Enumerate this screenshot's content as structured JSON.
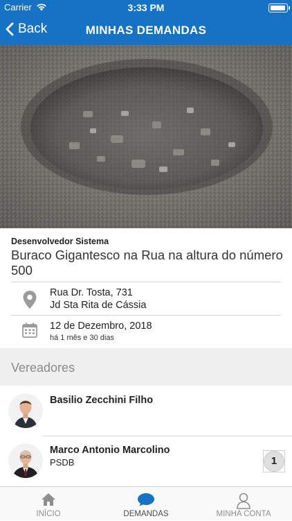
{
  "status_bar": {
    "carrier": "Carrier",
    "time": "3:33 PM"
  },
  "navbar": {
    "back_label": "Back",
    "title": "MINHAS DEMANDAS"
  },
  "demand": {
    "author": "Desenvolvedor Sistema",
    "title": "Buraco Gigantesco na Rua na altura do número 500",
    "address_line1": "Rua Dr. Tosta, 731",
    "address_line2": "Jd Sta Rita de Cássia",
    "date": "12 de Dezembro, 2018",
    "elapsed": "há 1 mês e 30 dias"
  },
  "section": {
    "title": "Vereadores"
  },
  "councilors": [
    {
      "name": "Basilio Zecchini Filho",
      "party": ""
    },
    {
      "name": "Marco Antonio Marcolino",
      "party": "PSDB",
      "badge": "1"
    }
  ],
  "tabbar": {
    "tabs": [
      {
        "label": "INÍCIO",
        "icon": "home-icon"
      },
      {
        "label": "DEMANDAS",
        "icon": "chat-bubble-icon",
        "active": true
      },
      {
        "label": "MINHA CONTA",
        "icon": "user-icon"
      }
    ]
  },
  "colors": {
    "brand": "#1672c4",
    "active_tab": "#1672c4"
  }
}
